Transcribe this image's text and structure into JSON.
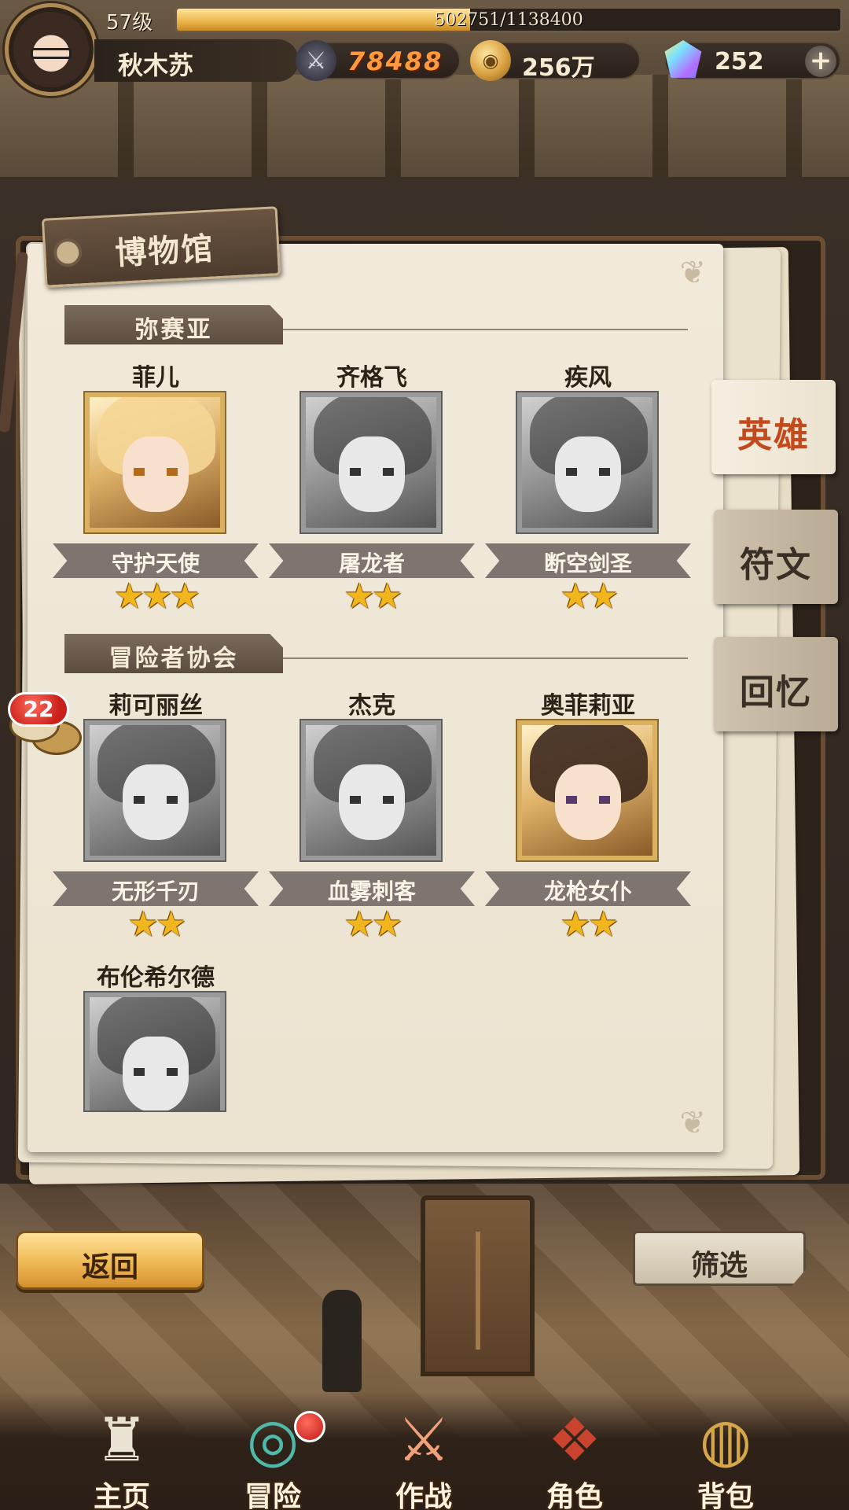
{
  "player": {
    "level": "57级",
    "exp": "502751/1138400",
    "exp_ratio": 0.4416,
    "name": "秋木苏",
    "power": "78488",
    "gold": "256万",
    "gems": "252"
  },
  "museum": {
    "title": "博物馆",
    "sections": [
      {
        "name": "弥赛亚",
        "heroes": [
          {
            "name": "菲儿",
            "title": "守护天使",
            "stars": 3,
            "owned": true
          },
          {
            "name": "齐格飞",
            "title": "屠龙者",
            "stars": 2,
            "owned": false
          },
          {
            "name": "疾风",
            "title": "断空剑圣",
            "stars": 2,
            "owned": false
          }
        ]
      },
      {
        "name": "冒险者协会",
        "heroes": [
          {
            "name": "莉可丽丝",
            "title": "无形千刃",
            "stars": 2,
            "owned": false
          },
          {
            "name": "杰克",
            "title": "血雾刺客",
            "stars": 2,
            "owned": false
          },
          {
            "name": "奥菲莉亚",
            "title": "龙枪女仆",
            "stars": 2,
            "owned": true
          },
          {
            "name": "布伦希尔德",
            "owned": false
          }
        ]
      }
    ]
  },
  "tabs": [
    {
      "label": "英雄",
      "active": true
    },
    {
      "label": "符文",
      "active": false
    },
    {
      "label": "回忆",
      "active": false
    }
  ],
  "chat": {
    "unread": "22"
  },
  "buttons": {
    "back": "返回",
    "filter": "筛选"
  },
  "nav": [
    {
      "label": "主页",
      "icon": "castle-icon"
    },
    {
      "label": "冒险",
      "icon": "portal-icon",
      "badge": true
    },
    {
      "label": "作战",
      "icon": "battle-icon"
    },
    {
      "label": "角色",
      "icon": "book-icon"
    },
    {
      "label": "背包",
      "icon": "backpack-icon"
    }
  ],
  "colors": {
    "accent_gold": "#f1b51e",
    "power_orange": "#ff9a3c",
    "active_tab_text": "#c24a1c"
  }
}
